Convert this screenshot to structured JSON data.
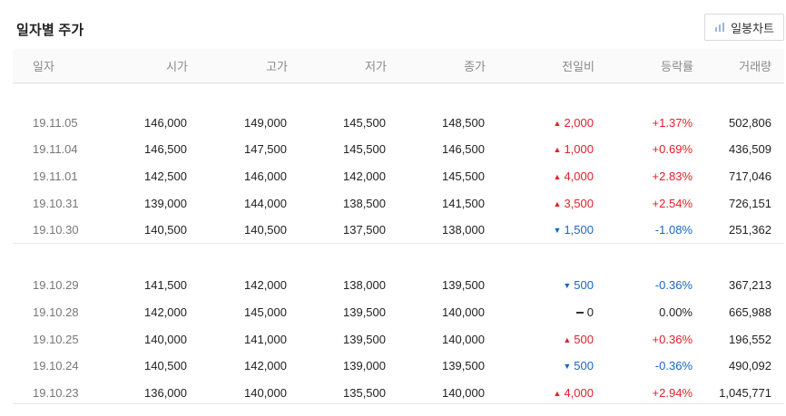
{
  "title": "일자별 주가",
  "chart_button": {
    "label": "일봉차트",
    "icon": "bar-chart-icon"
  },
  "columns": [
    "일자",
    "시가",
    "고가",
    "저가",
    "종가",
    "전일비",
    "등락률",
    "거래량"
  ],
  "colors": {
    "up": "#e0212a",
    "down": "#1a66c4"
  },
  "rows": [
    {
      "date": "19.11.05",
      "open": "146,000",
      "high": "149,000",
      "low": "145,500",
      "close": "148,500",
      "dir": "up",
      "change": "2,000",
      "rate": "+1.37%",
      "volume": "502,806"
    },
    {
      "date": "19.11.04",
      "open": "146,500",
      "high": "147,500",
      "low": "145,500",
      "close": "146,500",
      "dir": "up",
      "change": "1,000",
      "rate": "+0.69%",
      "volume": "436,509"
    },
    {
      "date": "19.11.01",
      "open": "142,500",
      "high": "146,000",
      "low": "142,000",
      "close": "145,500",
      "dir": "up",
      "change": "4,000",
      "rate": "+2.83%",
      "volume": "717,046"
    },
    {
      "date": "19.10.31",
      "open": "139,000",
      "high": "144,000",
      "low": "138,500",
      "close": "141,500",
      "dir": "up",
      "change": "3,500",
      "rate": "+2.54%",
      "volume": "726,151"
    },
    {
      "date": "19.10.30",
      "open": "140,500",
      "high": "140,500",
      "low": "137,500",
      "close": "138,000",
      "dir": "down",
      "change": "1,500",
      "rate": "-1.08%",
      "volume": "251,362"
    },
    {
      "date": "19.10.29",
      "open": "141,500",
      "high": "142,000",
      "low": "138,000",
      "close": "139,500",
      "dir": "down",
      "change": "500",
      "rate": "-0.36%",
      "volume": "367,213"
    },
    {
      "date": "19.10.28",
      "open": "142,000",
      "high": "145,000",
      "low": "139,500",
      "close": "140,000",
      "dir": "flat",
      "change": "0",
      "rate": "0.00%",
      "volume": "665,988"
    },
    {
      "date": "19.10.25",
      "open": "140,000",
      "high": "141,000",
      "low": "139,500",
      "close": "140,000",
      "dir": "up",
      "change": "500",
      "rate": "+0.36%",
      "volume": "196,552"
    },
    {
      "date": "19.10.24",
      "open": "140,500",
      "high": "142,000",
      "low": "139,000",
      "close": "139,500",
      "dir": "down",
      "change": "500",
      "rate": "-0.36%",
      "volume": "490,092"
    },
    {
      "date": "19.10.23",
      "open": "136,000",
      "high": "140,000",
      "low": "135,500",
      "close": "140,000",
      "dir": "up",
      "change": "4,000",
      "rate": "+2.94%",
      "volume": "1,045,771"
    }
  ]
}
